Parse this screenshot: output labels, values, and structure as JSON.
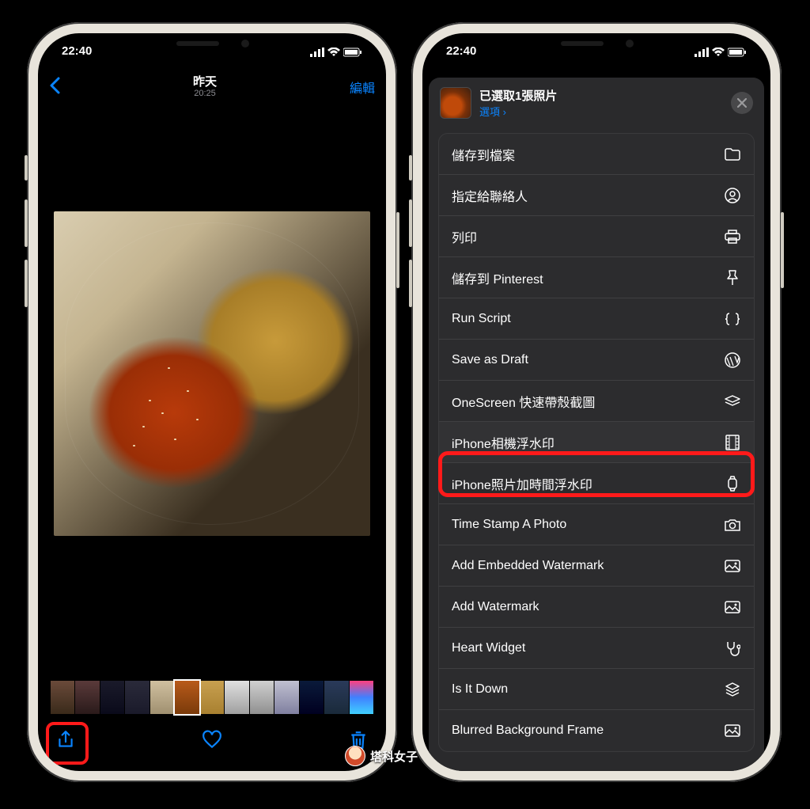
{
  "status": {
    "time": "22:40"
  },
  "left": {
    "nav": {
      "day": "昨天",
      "time": "20:25",
      "edit": "編輯"
    }
  },
  "right": {
    "sheet": {
      "title": "已選取1張照片",
      "options": "選項 ›"
    },
    "actions": [
      {
        "label": "儲存到檔案",
        "icon": "folder-icon"
      },
      {
        "label": "指定給聯絡人",
        "icon": "person-circle-icon"
      },
      {
        "label": "列印",
        "icon": "printer-icon"
      },
      {
        "label": "儲存到 Pinterest",
        "icon": "pin-icon"
      },
      {
        "label": "Run Script",
        "icon": "braces-icon"
      },
      {
        "label": "Save as Draft",
        "icon": "wordpress-icon"
      },
      {
        "label": "OneScreen  快速帶殼截圖",
        "icon": "stack-icon"
      },
      {
        "label": "iPhone相機浮水印",
        "icon": "film-icon",
        "highlight": true
      },
      {
        "label": "iPhone照片加時間浮水印",
        "icon": "watch-icon"
      },
      {
        "label": "Time Stamp A Photo",
        "icon": "camera-icon"
      },
      {
        "label": "Add Embedded Watermark",
        "icon": "picture-icon"
      },
      {
        "label": "Add Watermark",
        "icon": "picture-icon"
      },
      {
        "label": "Heart Widget",
        "icon": "stethoscope-icon"
      },
      {
        "label": "Is It Down",
        "icon": "layers-icon"
      },
      {
        "label": "Blurred Background Frame",
        "icon": "picture-icon"
      }
    ]
  },
  "watermark": "塔科女子"
}
